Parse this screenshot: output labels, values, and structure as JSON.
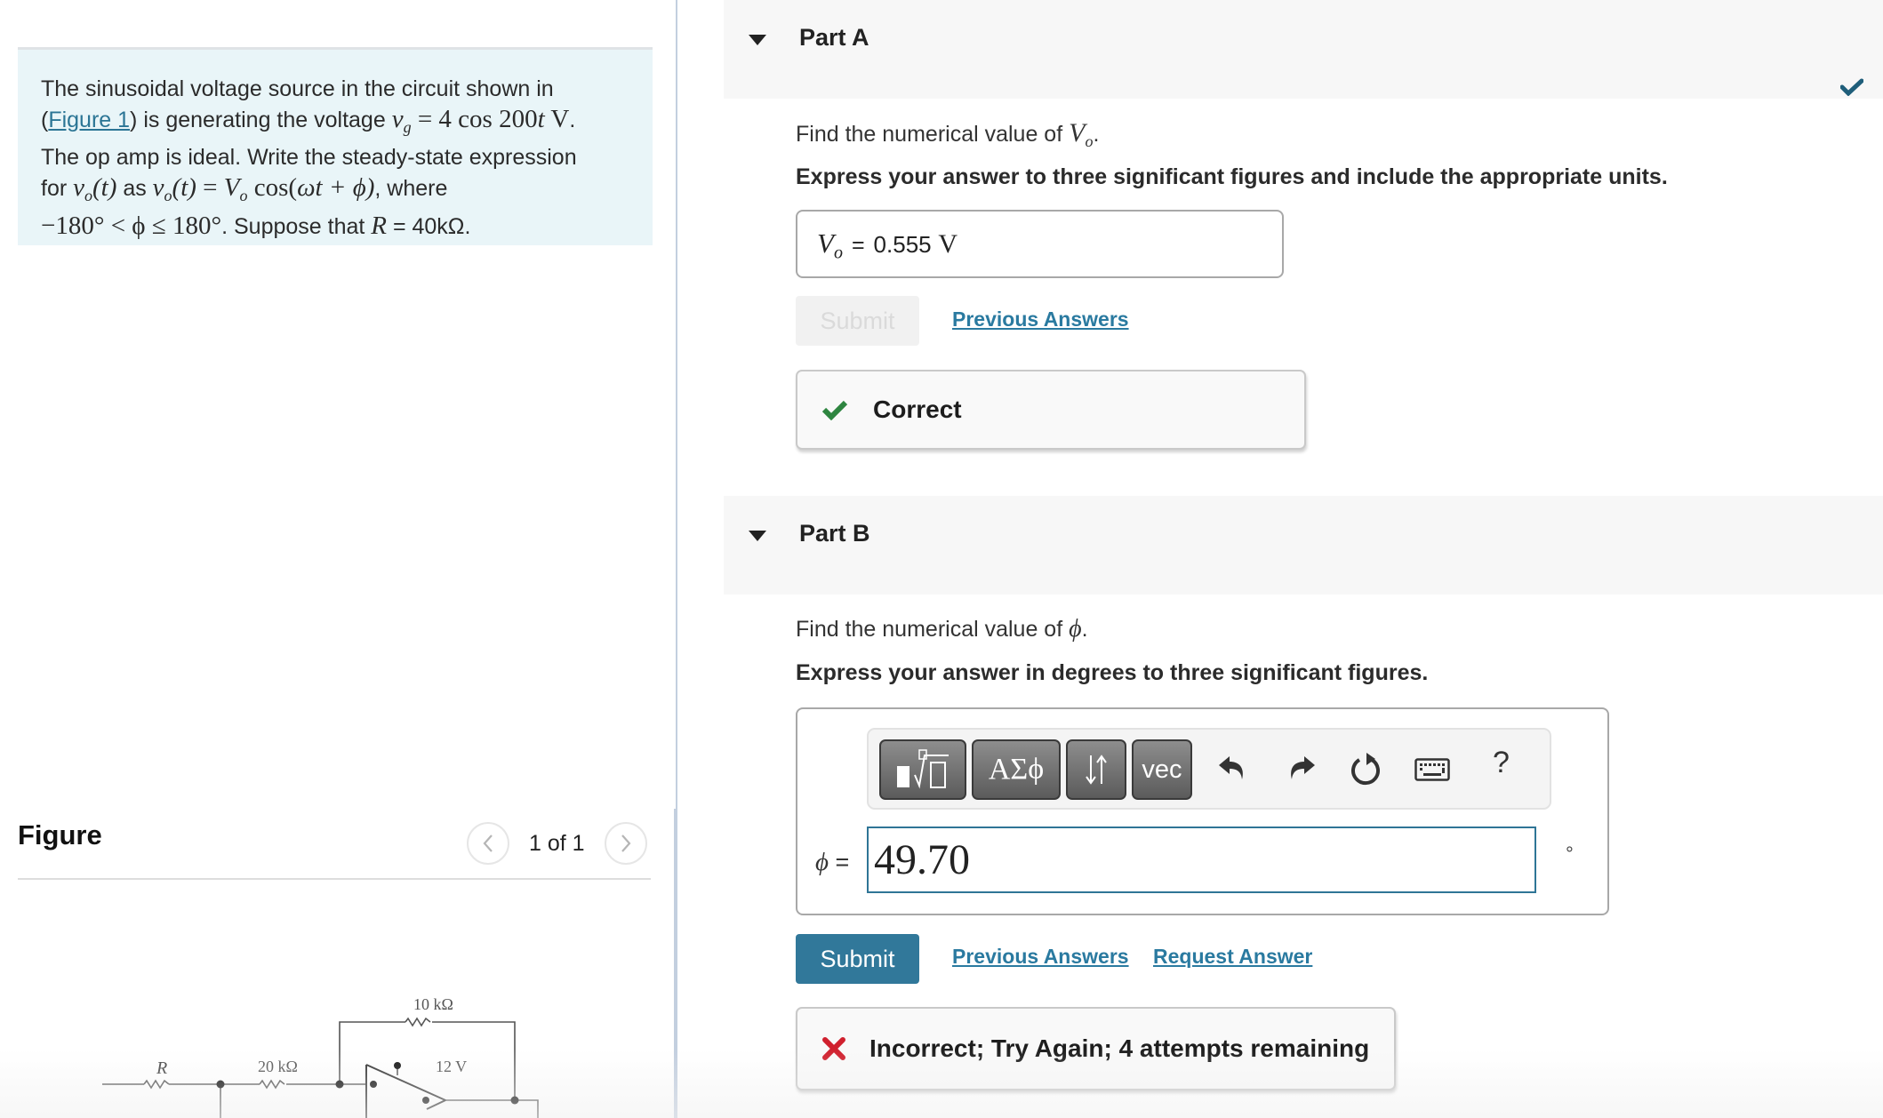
{
  "problem": {
    "text_1": "The sinusoidal voltage source in the circuit shown in",
    "paren_open": "(",
    "figure_link": "Figure 1",
    "text_2": ") is generating the voltage ",
    "vg_symbol": "v",
    "vg_sub": "g",
    "vg_expr": " = 4 cos 200",
    "vg_t": "t",
    "vg_unit": " V",
    "period": ".",
    "text_3": "The op amp is ideal. Write the steady-state expression",
    "text_4_for": "for ",
    "vo_t": "v",
    "vo_sub": "o",
    "t_paren": "(t)",
    "text_4_as": " as ",
    "vo_expr_eq": " = ",
    "Vo": "V",
    "Vo_sub": "o",
    "cos_expr": " cos(",
    "omega_t": "ωt",
    "plus_phi": " + ϕ)",
    "text_4_where": ", where",
    "range_expr": "−180° < ϕ ≤ 180°",
    "text_5": ". Suppose that ",
    "R_symbol": "R",
    "R_value": " = 40kΩ",
    "end_period": "."
  },
  "figure": {
    "title": "Figure",
    "counter": "1 of 1",
    "prev_icon": "chevron-left-icon",
    "next_icon": "chevron-right-icon",
    "labels": {
      "R": "R",
      "r20": "20 kΩ",
      "r10": "10 kΩ",
      "supply": "12 V"
    }
  },
  "partA": {
    "title": "Part A",
    "status": "correct",
    "question_prefix": "Find the numerical value of ",
    "question_var": "V",
    "question_var_sub": "o",
    "question_suffix": ".",
    "instruction": "Express your answer to three significant figures and include the appropriate units.",
    "answer_var": "V",
    "answer_var_sub": "o",
    "answer_eq": "=",
    "answer_value": "0.555",
    "answer_unit": "V",
    "submit_label": "Submit",
    "previous_answers_label": "Previous Answers",
    "feedback": "Correct",
    "feedback_color": "#2e8540"
  },
  "partB": {
    "title": "Part B",
    "question_prefix": "Find the numerical value of ",
    "question_var": "ϕ",
    "question_suffix": ".",
    "instruction": "Express your answer in degrees to three significant figures.",
    "toolbar": {
      "templates_label": "√",
      "greek_label": "ΑΣϕ",
      "arrows_label": "⇃↾",
      "vec_label": "vec",
      "undo_icon": "undo-icon",
      "redo_icon": "redo-icon",
      "reset_icon": "reset-icon",
      "keyboard_icon": "keyboard-icon",
      "help_label": "?"
    },
    "input_label": "ϕ =",
    "input_value": "49.70",
    "unit_symbol": "°",
    "submit_label": "Submit",
    "previous_answers_label": "Previous Answers",
    "request_answer_label": "Request Answer",
    "feedback": "Incorrect; Try Again; 4 attempts remaining",
    "feedback_color": "#d0202e"
  },
  "colors": {
    "accent": "#31789a",
    "link": "#2a7aa0",
    "check_header": "#1f5e7a",
    "intro_bg": "#e9f5f8"
  }
}
